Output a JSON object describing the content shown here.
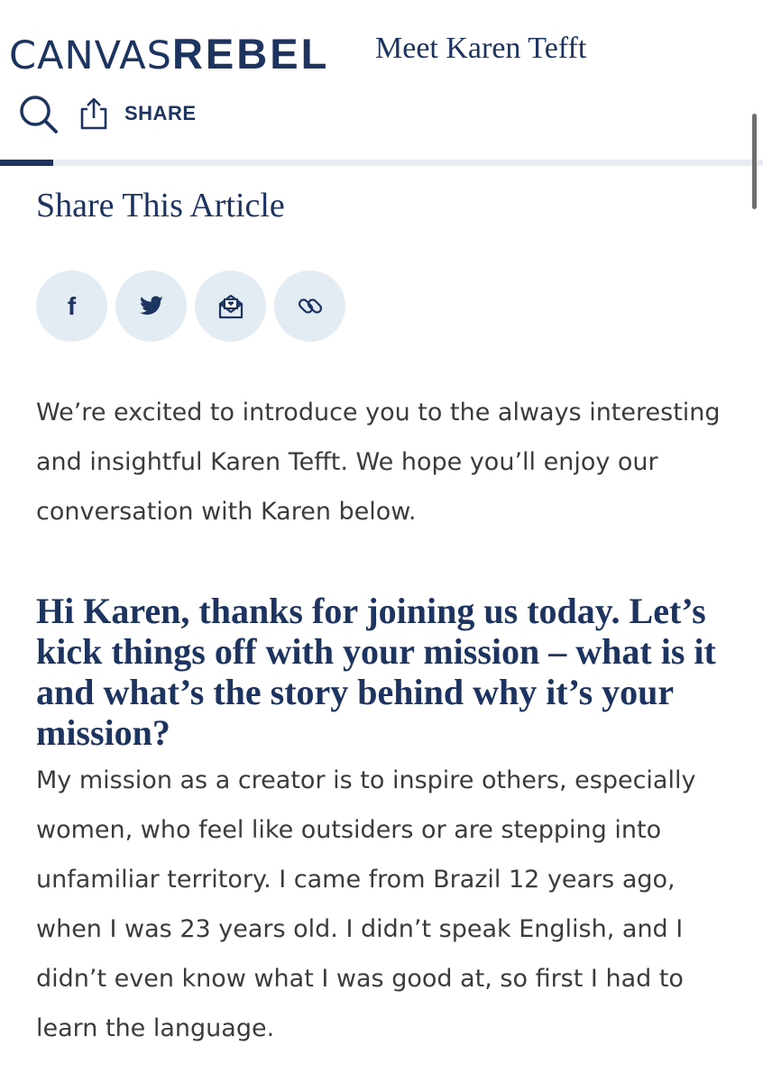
{
  "header": {
    "logo_light": "CANVAS",
    "logo_bold": "REBEL",
    "title": "Meet Karen Tefft",
    "share_label": "SHARE",
    "search_icon": "search-icon",
    "share_icon": "share-upload-icon",
    "reading_progress": 0.07
  },
  "colors": {
    "brand": "#1d3461",
    "social_bg": "#e3ebf3",
    "body_text": "#3b3b3b"
  },
  "share_section": {
    "title": "Share This Article",
    "buttons": [
      {
        "icon": "facebook-icon",
        "label": "f"
      },
      {
        "icon": "twitter-icon"
      },
      {
        "icon": "email-icon"
      },
      {
        "icon": "copy-link-icon"
      }
    ]
  },
  "article": {
    "intro": "We’re excited to introduce you to the always interesting and insightful Karen Tefft.  We hope you’ll enjoy our conversation with Karen below.",
    "question": "Hi Karen, thanks for joining us today. Let’s kick things off with your mission – what is it and what’s the story behind why it’s your mission?",
    "answer": "My mission as a creator is to inspire others, especially women, who feel like outsiders or are stepping into unfamiliar territory. I came from Brazil 12 years ago, when I was 23 years old. I didn’t speak English, and I didn’t even know what I was good at, so first I had to learn the language."
  }
}
